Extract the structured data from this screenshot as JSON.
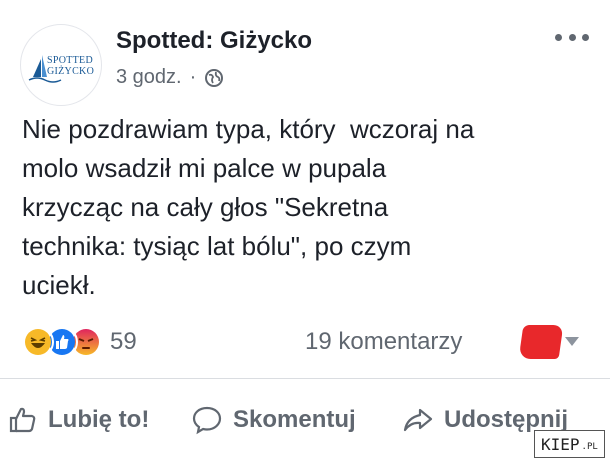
{
  "header": {
    "avatar_logo_line1": "SPOTTED",
    "avatar_logo_line2": "GIŻYCKO",
    "page_name": "Spotted: Giżycko",
    "timestamp": "3 godz.",
    "separator": "·",
    "privacy_icon": "globe-icon",
    "more_icon": "more-options-icon"
  },
  "post": {
    "text": "Nie pozdrawiam typa, który  wczoraj na\nmolo wsadził mi palce w pupala\nkrzycząc na cały głos \"Sekretna\ntechnika: tysiąc lat bólu\", po czym\nuciekł."
  },
  "reactions": {
    "icons": [
      "haha-reaction-icon",
      "like-reaction-icon",
      "angry-reaction-icon"
    ],
    "count": "59"
  },
  "comments": {
    "count_label": "19 komentarzy"
  },
  "actions": {
    "like_label": "Lubię to!",
    "comment_label": "Skomentuj",
    "share_label": "Udostępnij"
  },
  "watermark": {
    "text": "KIEP",
    "suffix": ".PL"
  },
  "colors": {
    "text": "#1d2129",
    "secondary": "#606770",
    "like_blue": "#1877f2",
    "haha_yellow": "#f7b928",
    "angry_red": "#e9710f",
    "redaction": "#e8282b"
  }
}
